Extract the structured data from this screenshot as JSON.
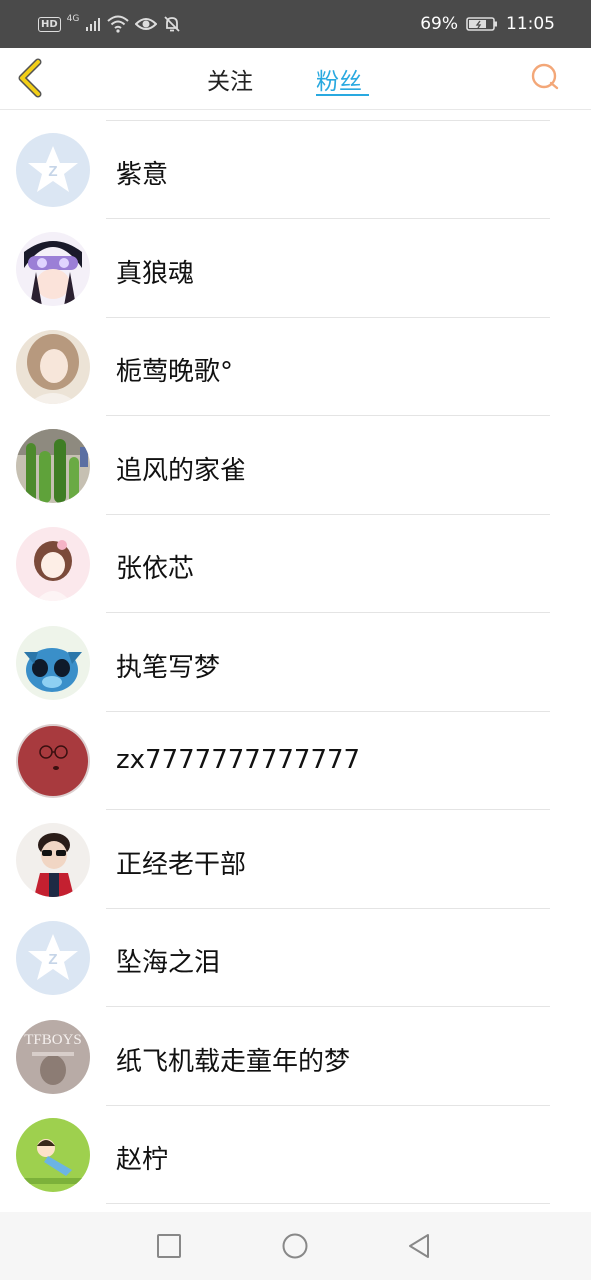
{
  "status_bar": {
    "left_icons": [
      "hd-icon",
      "4g-signal-icon",
      "wifi-icon",
      "eye-icon",
      "mute-bell-icon"
    ],
    "hd_label": "HD",
    "network_label": "4G",
    "battery_percent": "69%",
    "time": "11:05"
  },
  "header": {
    "back_icon": "chevron-left-icon",
    "tabs": [
      {
        "label": "关注",
        "active": false
      },
      {
        "label": "粉丝",
        "active": true
      }
    ],
    "search_icon": "search-icon"
  },
  "fans": [
    {
      "name": "紫意",
      "avatar": "default-qq-avatar"
    },
    {
      "name": "真狼魂",
      "avatar": "anime-goggles-avatar"
    },
    {
      "name": "栀莺晚歌°",
      "avatar": "girl-photo-avatar"
    },
    {
      "name": "追风的家雀",
      "avatar": "cactus-avatar"
    },
    {
      "name": "张依芯",
      "avatar": "anime-girl-avatar"
    },
    {
      "name": "执笔写梦",
      "avatar": "stitch-avatar"
    },
    {
      "name": "zx7777777777777",
      "avatar": "red-ball-avatar"
    },
    {
      "name": "正经老干部",
      "avatar": "boy-sunglasses-avatar"
    },
    {
      "name": "坠海之泪",
      "avatar": "default-qq-avatar"
    },
    {
      "name": "纸飞机载走童年的梦",
      "avatar": "tfboys-avatar"
    },
    {
      "name": "赵柠",
      "avatar": "cartoon-kid-avatar"
    }
  ],
  "colors": {
    "accent": "#29a9e0",
    "back_arrow": "#e8b800",
    "search": "#f0a070",
    "status_bar_bg": "#4a4a4a"
  },
  "nav": {
    "items": [
      "recent-apps-icon",
      "home-icon",
      "back-icon"
    ]
  }
}
